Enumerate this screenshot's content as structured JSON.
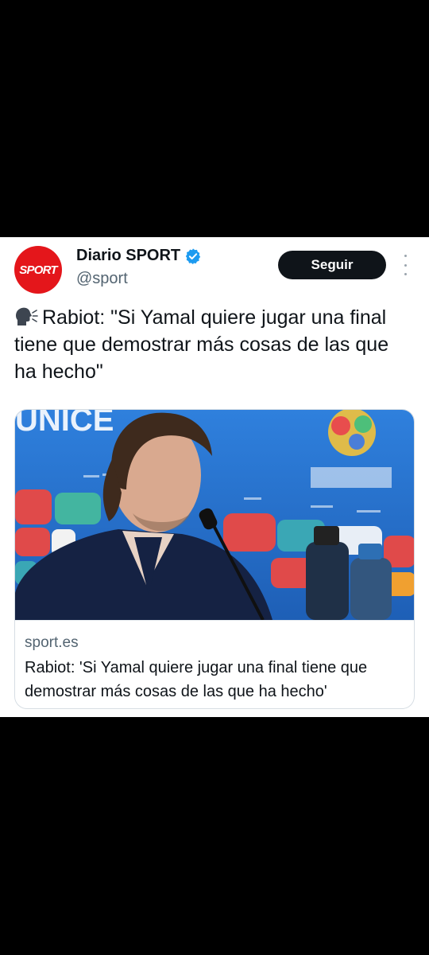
{
  "account": {
    "avatar_text": "SPORT",
    "display_name": "Diario SPORT",
    "handle": "@sport",
    "verified_icon": "verified-badge-icon",
    "brand_color": "#e4161b",
    "verified_color": "#1d9bf0"
  },
  "actions": {
    "follow_label": "Seguir",
    "more_icon": "more-vertical-icon"
  },
  "tweet": {
    "speaker_icon": "speaking-head-icon",
    "text": "Rabiot: \"Si Yamal quiere jugar una final tiene que demostrar más cosas de las que ha hecho\""
  },
  "link_card": {
    "image": "press-conference-photo",
    "domain": "sport.es",
    "headline": "Rabiot: 'Si Yamal quiere jugar una final tiene que demostrar más cosas de las que ha hecho'"
  }
}
